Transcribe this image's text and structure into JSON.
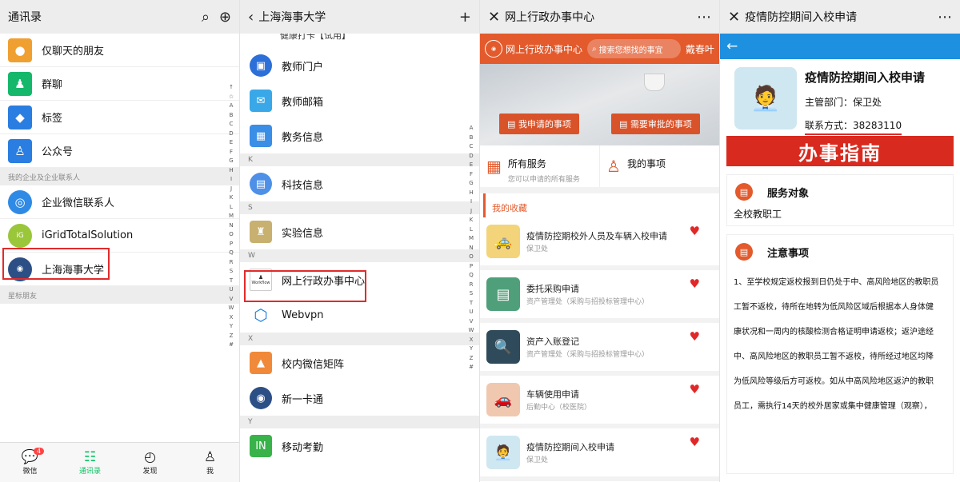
{
  "contacts": {
    "title": "通讯录",
    "items": [
      "仅聊天的朋友",
      "群聊",
      "标签",
      "公众号"
    ],
    "section_enterprise": "我的企业及企业联系人",
    "enterprise": [
      "企业微信联系人",
      "iGridTotalSolution",
      "上海海事大学"
    ],
    "section_star": "星标朋友",
    "alpha": [
      "↑",
      "☆",
      "A",
      "B",
      "C",
      "D",
      "E",
      "F",
      "G",
      "H",
      "I",
      "J",
      "K",
      "L",
      "M",
      "N",
      "O",
      "P",
      "Q",
      "R",
      "S",
      "T",
      "U",
      "V",
      "W",
      "X",
      "Y",
      "Z",
      "#"
    ],
    "tabs": [
      {
        "label": "微信",
        "badge": "4"
      },
      {
        "label": "通讯录"
      },
      {
        "label": "发现"
      },
      {
        "label": "我"
      }
    ]
  },
  "university": {
    "title": "上海海事大学",
    "cut_item": "健康打卡【试用】",
    "items1": [
      "教师门户",
      "教师邮箱",
      "教务信息"
    ],
    "sec_k": "K",
    "k_items": [
      "科技信息"
    ],
    "sec_s": "S",
    "s_items": [
      "实验信息"
    ],
    "sec_w": "W",
    "w_items": [
      "网上行政办事中心",
      "Webvpn"
    ],
    "sec_x": "X",
    "x_items": [
      "校内微信矩阵",
      "新一卡通"
    ],
    "sec_y": "Y",
    "y_items": [
      "移动考勤"
    ],
    "workflow_tag": "Workflow",
    "alpha": [
      "A",
      "B",
      "C",
      "D",
      "E",
      "F",
      "G",
      "H",
      "I",
      "J",
      "K",
      "L",
      "M",
      "N",
      "O",
      "P",
      "Q",
      "R",
      "S",
      "T",
      "U",
      "V",
      "W",
      "X",
      "Y",
      "Z",
      "#"
    ]
  },
  "office": {
    "title": "网上行政办事中心",
    "header_name": "网上行政办事中心",
    "search_placeholder": "搜索您想找的事宜",
    "user": "戴春叶",
    "btn_mine": "我申请的事项",
    "btn_approve": "需要审批的事项",
    "svc_all": "所有服务",
    "svc_all_sub": "您可以申请的所有服务",
    "svc_mine": "我的事项",
    "fav_title": "我的收藏",
    "favorites": [
      {
        "title": "疫情防控期校外人员及车辆入校申请",
        "dept": "保卫处"
      },
      {
        "title": "委托采购申请",
        "dept": "资产管理处（采购与招投标管理中心）"
      },
      {
        "title": "资产入账登记",
        "dept": "资产管理处（采购与招投标管理中心）"
      },
      {
        "title": "车辆使用申请",
        "dept": "后勤中心（校医院）"
      },
      {
        "title": "疫情防控期间入校申请",
        "dept": "保卫处"
      }
    ]
  },
  "detail": {
    "title": "疫情防控期间入校申请",
    "name": "疫情防控期间入校申请",
    "dept": "主管部门：保卫处",
    "contact": "联系方式：38283110",
    "guide": "办事指南",
    "target_h": "服务对象",
    "target": "全校教职工",
    "notice_h": "注意事项",
    "lines": [
      "1、至学校规定返校报到日仍处于中、高风险地区的教职员",
      "工暂不返校，待所在地转为低风险区域后根据本人身体健",
      "康状况和一周内的核酸检测合格证明申请返校；返沪途经",
      "中、高风险地区的教职员工暂不返校，待所经过地区均降",
      "为低风险等级后方可返校。如从中高风险地区返沪的教职",
      "员工，需执行14天的校外居家或集中健康管理（观察），"
    ]
  }
}
